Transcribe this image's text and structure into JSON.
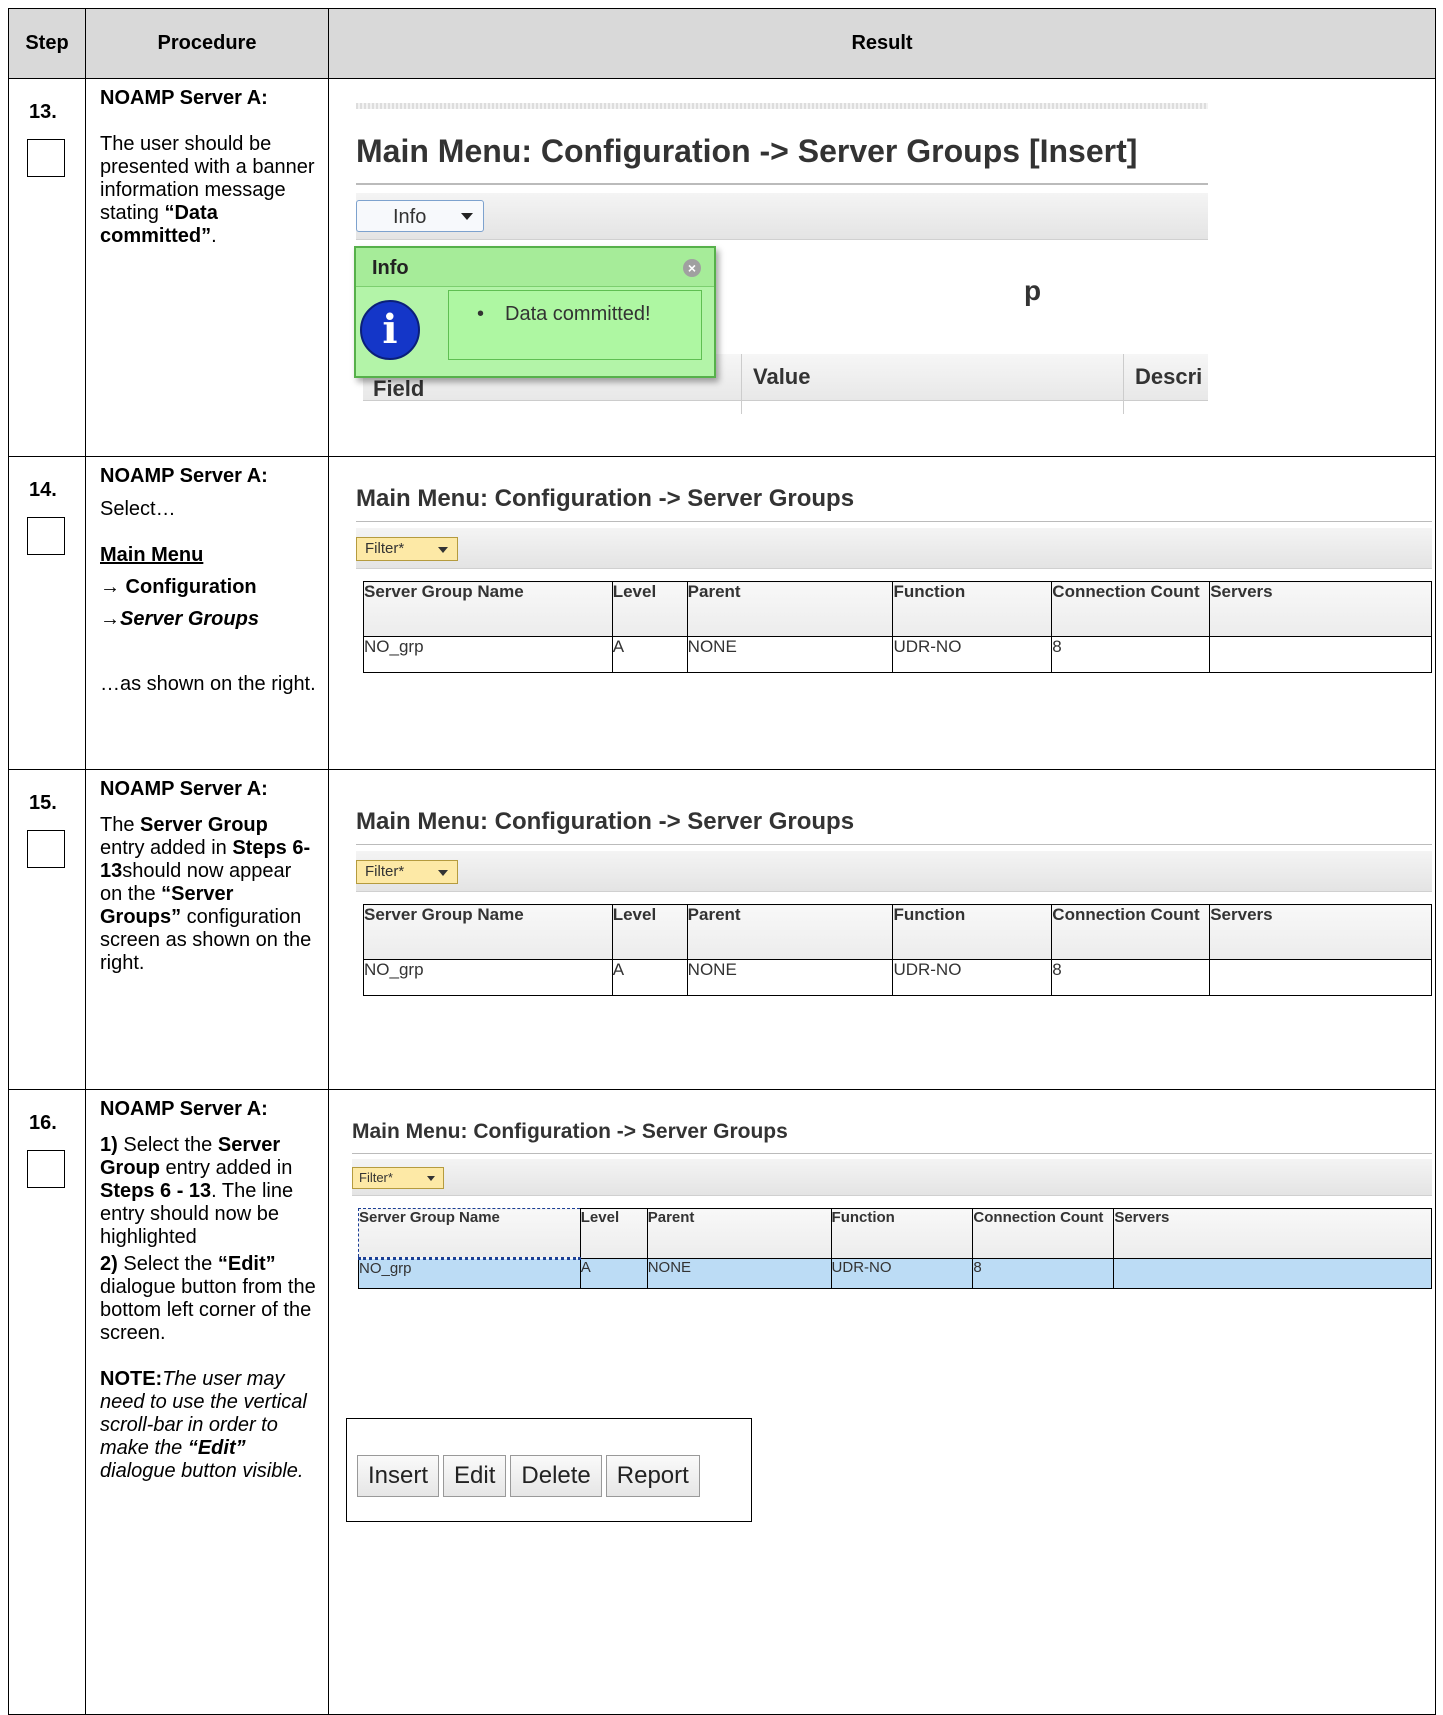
{
  "headers": {
    "step": "Step",
    "procedure": "Procedure",
    "result": "Result"
  },
  "rows": [
    {
      "step": "13.",
      "server": "NOAMP Server A:",
      "text_pre": "The user should be presented with a banner information message stating ",
      "text_bold": "“Data committed”",
      "text_post": ".",
      "ui": {
        "title": "Main Menu: Configuration -> Server Groups [Insert]",
        "info_button": "Info",
        "popup_title": "Info",
        "popup_message": "Data committed!",
        "info_glyph": "i",
        "bg_partial_heading": "p",
        "col_field_partial": "Field",
        "col_value": "Value",
        "col_descr_partial": "Descri"
      }
    },
    {
      "step": "14.",
      "server": "NOAMP Server A:",
      "select": "Select…",
      "menu_main": "Main Menu",
      "menu_config": "→ Configuration",
      "menu_groups": "→Server Groups",
      "as_shown": "…as shown on the right.",
      "ui": {
        "title": "Main Menu: Configuration -> Server Groups",
        "filter": "Filter*"
      }
    },
    {
      "step": "15.",
      "server": "NOAMP Server A:",
      "t1": "The ",
      "b1": "Server Group",
      "t2": " entry added in ",
      "b2": "Steps 6- 13",
      "t3": "should now appear on the ",
      "b3": "“Server Groups”",
      "t4": " configuration screen as shown on the right.",
      "ui": {
        "title": "Main Menu: Configuration -> Server Groups",
        "filter": "Filter*"
      }
    },
    {
      "step": "16.",
      "server": "NOAMP Server A:",
      "s1_num": "1)",
      "s1_t1": " Select the ",
      "s1_b1": "Server Group",
      "s1_t2": " entry added in ",
      "s1_b2": "Steps 6 - 13",
      "s1_t3": ". The line entry should now be highlighted",
      "s2_num": "2)",
      "s2_t1": " Select the ",
      "s2_b1": "“Edit”",
      "s2_t2": " dialogue button from the bottom left corner of the screen.",
      "note_label": "NOTE:",
      "note_i1": "The user may need to use the vertical scroll-bar in order to make the ",
      "note_bi": "“Edit”",
      "note_i2": " dialogue button visible.",
      "ui": {
        "title": "Main Menu: Configuration -> Server Groups",
        "filter": "Filter*",
        "buttons": {
          "insert": "Insert",
          "edit": "Edit",
          "delete": "Delete",
          "report": "Report"
        }
      }
    }
  ],
  "server_groups": {
    "columns": [
      "Server Group Name",
      "Level",
      "Parent",
      "Function",
      "Connection Count",
      "Servers"
    ],
    "row": [
      "NO_grp",
      "A",
      "NONE",
      "UDR-NO",
      "8",
      ""
    ]
  },
  "colors": {
    "info_green": "#b3f4a8",
    "info_border": "#56b04a",
    "info_icon": "#1436c8",
    "highlight": "#bcdcf5",
    "filter_bg": "#fde9a6"
  }
}
